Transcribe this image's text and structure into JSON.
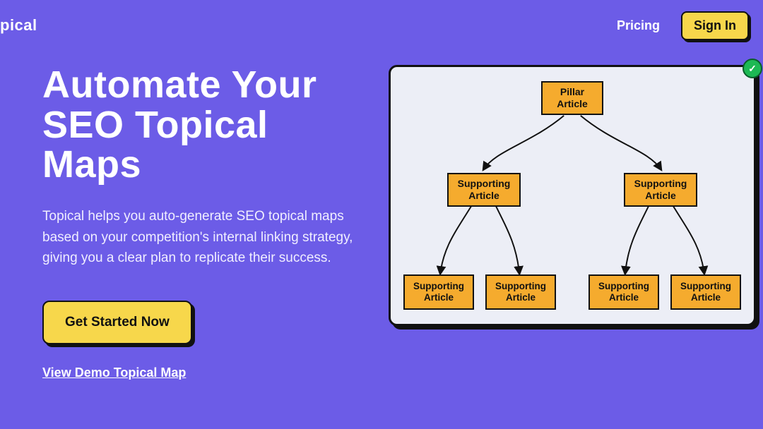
{
  "header": {
    "logo_fragment": "pical",
    "pricing": "Pricing",
    "signin": "Sign In"
  },
  "hero": {
    "headline": "Automate Your SEO Topical Maps",
    "subhead": "Topical helps you auto-generate SEO topical maps based on your competition's internal linking strategy, giving you a clear plan to replicate their success.",
    "cta": "Get Started Now",
    "demo_link": "View Demo Topical Map"
  },
  "diagram": {
    "root": "Pillar Article",
    "mid_left": "Supporting Article",
    "mid_right": "Supporting Article",
    "leaf1": "Supporting Article",
    "leaf2": "Supporting Article",
    "leaf3": "Supporting Article",
    "leaf4": "Supporting Article",
    "badge_glyph": "✓"
  }
}
